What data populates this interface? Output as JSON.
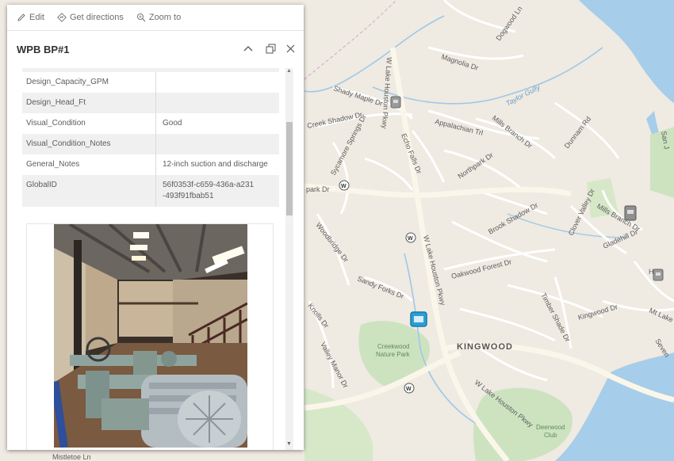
{
  "map": {
    "city_label": "KINGWOOD",
    "park_labels": [
      "Creekwood",
      "Nature Park",
      "Deerwood",
      "Club"
    ],
    "water_label": "Taylor Gully",
    "road_labels": [
      "Dogwood Ln",
      "Magnolia Dr",
      "Shady Maple Dr",
      "Creek Shadow Dr",
      "Appalachian Trl",
      "Mills Branch Dr",
      "Dunnam Rd",
      "Sycamore Springs Dr",
      "Echo Falls Dr",
      "Northpark Dr",
      "park Dr",
      "Clover Valley Dr",
      "Mills Branch Dr",
      "Woodbridge Dr",
      "Brook Shadow Dr",
      "Gladehill Dr",
      "Oakwood Forest Dr",
      "Sandy Forks Dr",
      "Timber Shade Dr",
      "Kingwood Dr",
      "Mt Lake",
      "Knolls Dr",
      "Valley Manor Dr",
      "W Lake Houston Pkwy",
      "W Lake Houston Pkwy",
      "W Lake Houston Pkwy",
      "Mistletoe Ln",
      "Hi",
      "San J",
      "Seven"
    ]
  },
  "toolbar": {
    "edit": "Edit",
    "directions": "Get directions",
    "zoom": "Zoom to"
  },
  "popup": {
    "title": "WPB BP#1",
    "attributes": [
      {
        "key": "Design_Capacity_GPM",
        "value": ""
      },
      {
        "key": "Design_Head_Ft",
        "value": ""
      },
      {
        "key": "Visual_Condition",
        "value": "Good"
      },
      {
        "key": "Visual_Condition_Notes",
        "value": ""
      },
      {
        "key": "General_Notes",
        "value": "12-inch suction and discharge"
      },
      {
        "key": "GlobalID",
        "value": "56f0353f-c659-436a-a231-493f91fbab51"
      }
    ]
  },
  "colors": {
    "map_bg": "#efeae2",
    "water": "#a6cde9",
    "park": "#cde3c0",
    "road": "#ffffff",
    "highway": "#fbf6ea"
  }
}
